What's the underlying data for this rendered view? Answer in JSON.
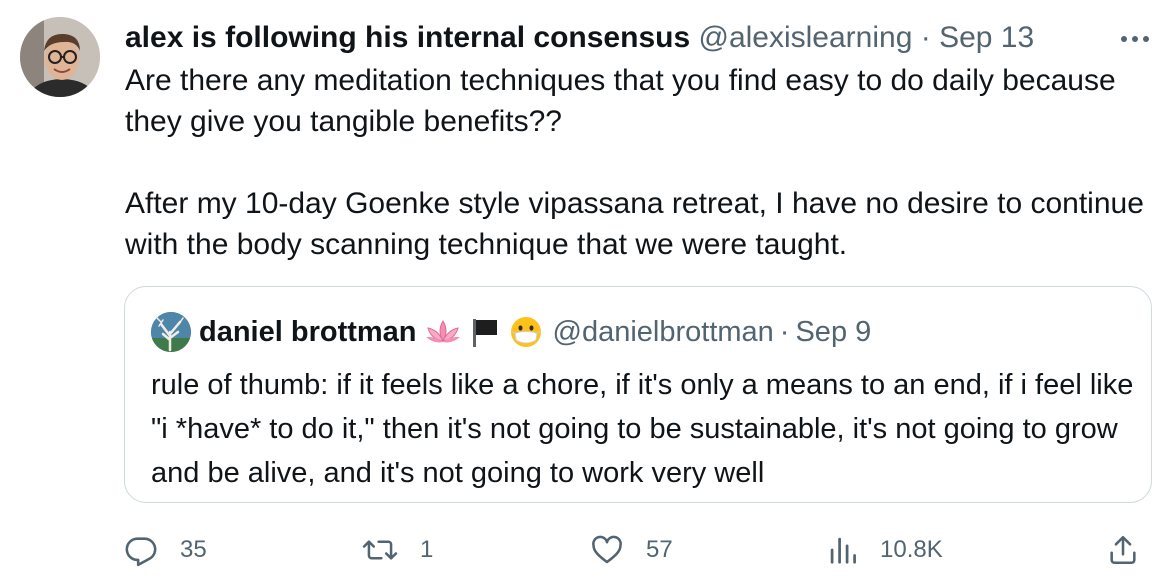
{
  "author": {
    "display_name": "alex is following his internal consensus",
    "handle": "@alexislearning",
    "separator": "·",
    "date": "Sep 13",
    "avatar_icon": "user-avatar"
  },
  "tweet": {
    "text": "Are there any meditation techniques that you find easy to do daily because they give you tangible benefits??\n\nAfter my 10-day Goenke style vipassana retreat, I have no desire to continue with the body scanning technique that we were taught."
  },
  "quoted_tweet": {
    "display_name": "daniel brottman",
    "emojis": [
      "lotus-icon",
      "black-flag-icon",
      "face-with-mask-icon"
    ],
    "handle": "@danielbrottman",
    "separator": "·",
    "date": "Sep 9",
    "text": "rule of thumb: if it feels like a chore, if it's only a means to an end, if i feel like \"i *have* to do it,\" then it's not going to be sustainable, it's not going to grow and be alive, and it's not going to work very well"
  },
  "actions": {
    "reply": {
      "icon": "reply-icon",
      "count": "35"
    },
    "retweet": {
      "icon": "retweet-icon",
      "count": "1"
    },
    "like": {
      "icon": "heart-icon",
      "count": "57"
    },
    "views": {
      "icon": "views-icon",
      "count": "10.8K"
    },
    "share": {
      "icon": "share-icon"
    }
  },
  "colors": {
    "text_primary": "#0f1419",
    "text_secondary": "#536471",
    "border": "#cfd9de"
  }
}
